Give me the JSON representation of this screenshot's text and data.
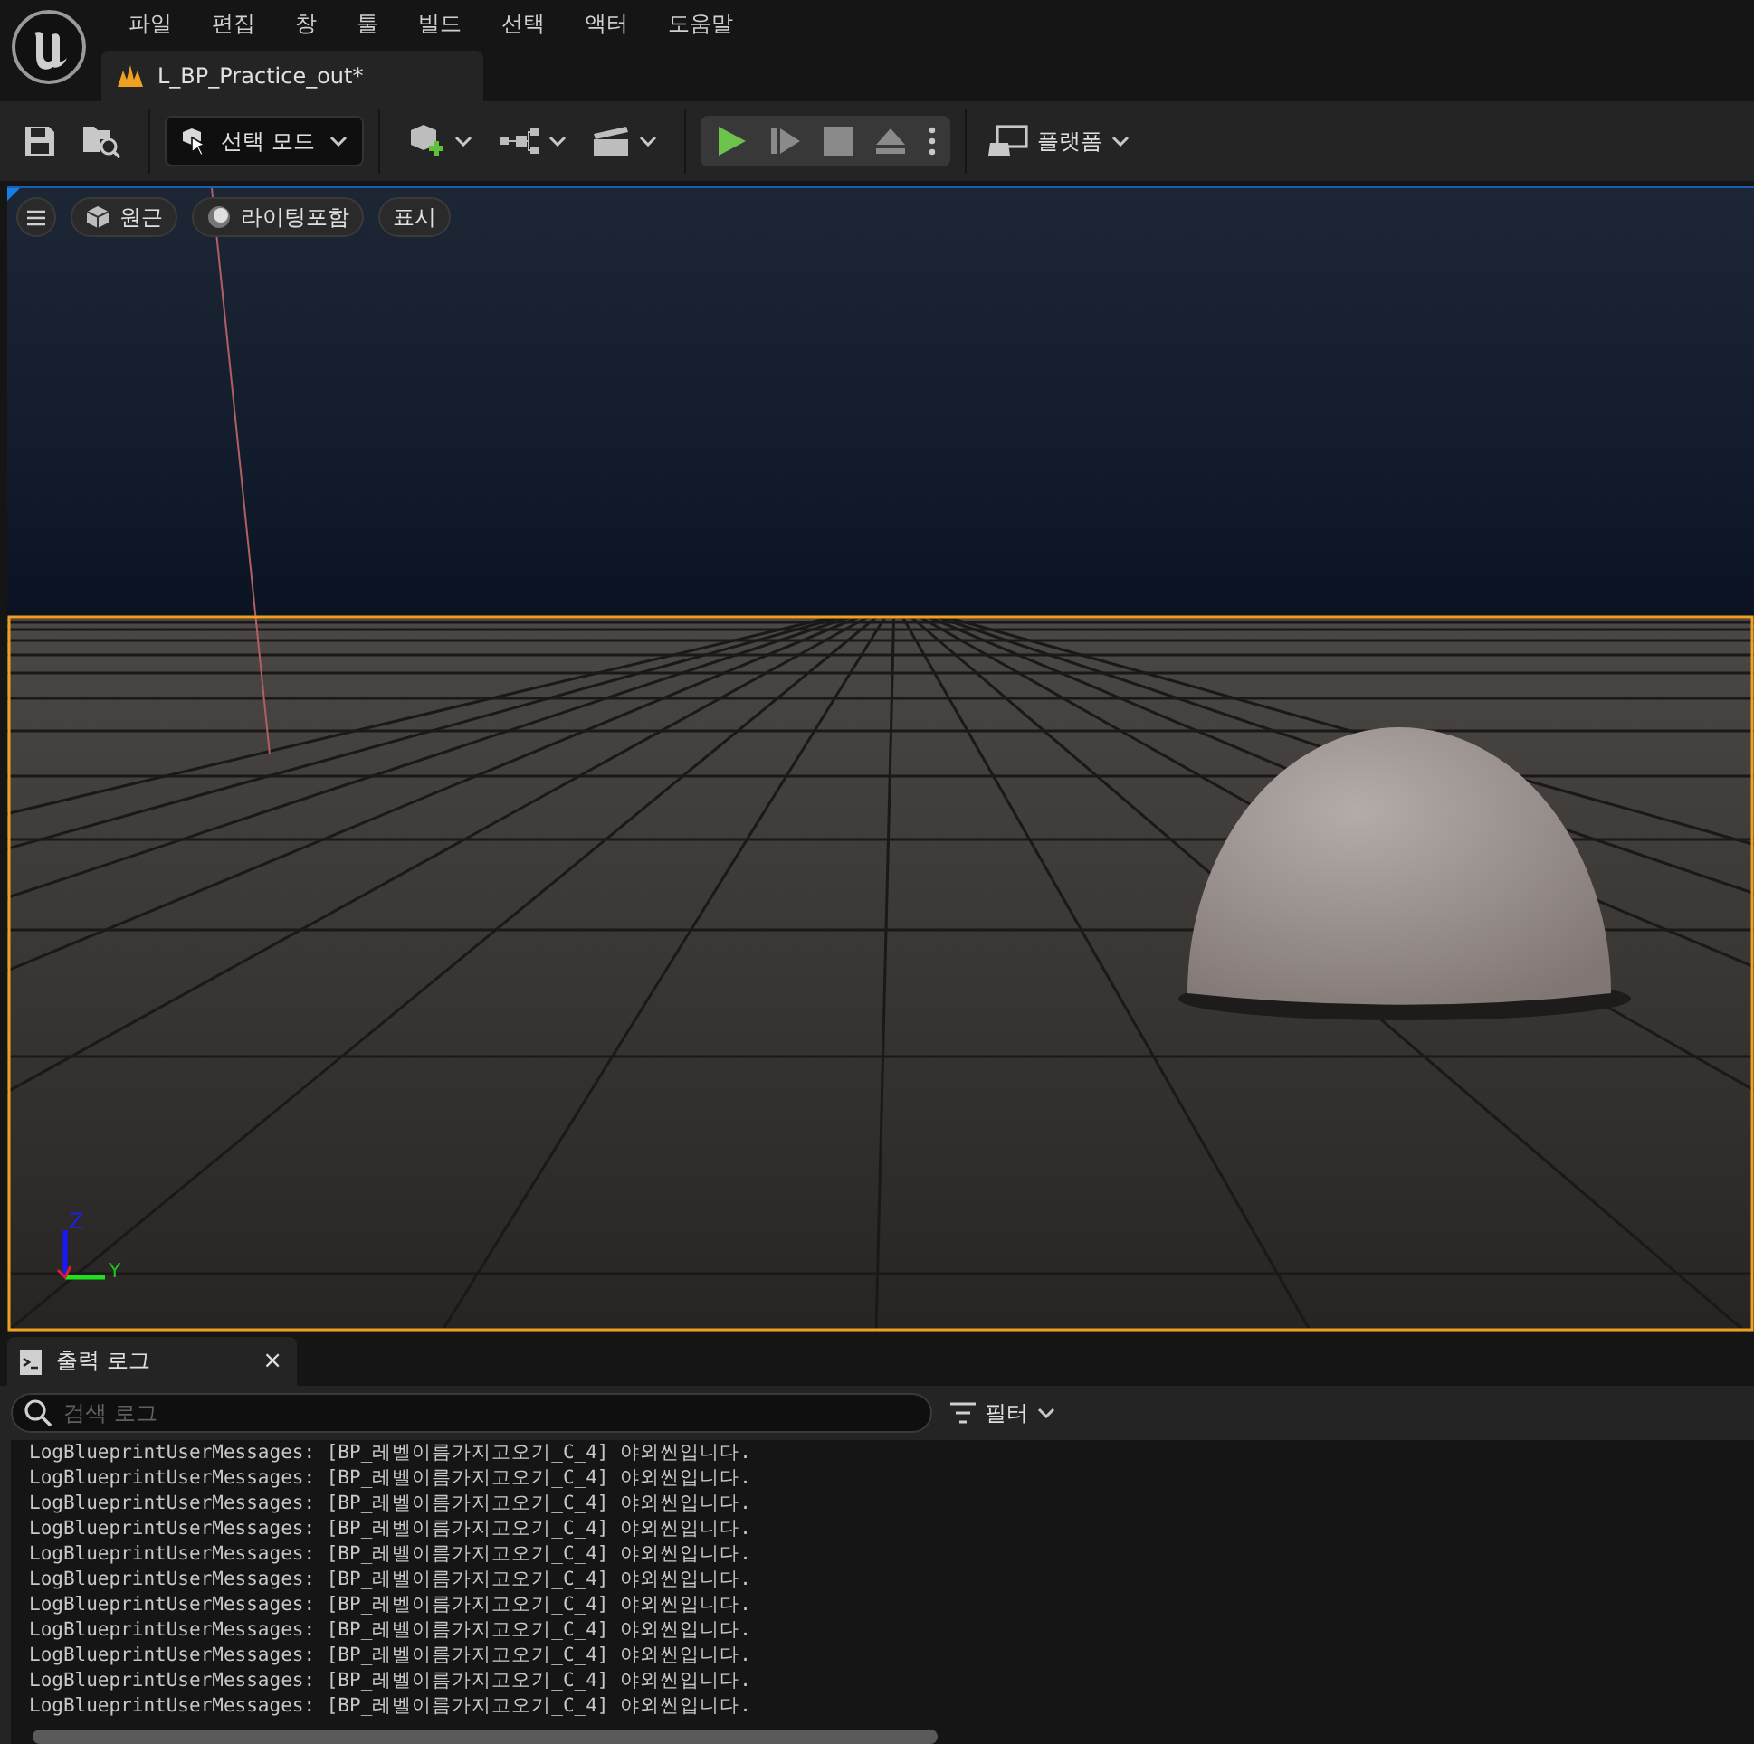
{
  "menu": [
    "파일",
    "편집",
    "창",
    "툴",
    "빌드",
    "선택",
    "액터",
    "도움말"
  ],
  "document_tab": {
    "title": "L_BP_Practice_out*"
  },
  "toolbar": {
    "mode_button": "선택 모드",
    "platform_button": "플랫폼"
  },
  "viewport": {
    "buttons": [
      {
        "label": "원근",
        "kind": "perspective"
      },
      {
        "label": "라이팅포함",
        "kind": "lit"
      },
      {
        "label": "표시",
        "kind": "show"
      }
    ],
    "axes": [
      "Z",
      "Y"
    ]
  },
  "output_log": {
    "tab": "출력 로그",
    "close": "×",
    "search": {
      "placeholder": "검색 로그"
    },
    "filter": "필터",
    "lines": [
      "LogBlueprintUserMessages: [BP_레벨이름가지고오기_C_4] 야외씬입니다.",
      "LogBlueprintUserMessages: [BP_레벨이름가지고오기_C_4] 야외씬입니다.",
      "LogBlueprintUserMessages: [BP_레벨이름가지고오기_C_4] 야외씬입니다.",
      "LogBlueprintUserMessages: [BP_레벨이름가지고오기_C_4] 야외씬입니다.",
      "LogBlueprintUserMessages: [BP_레벨이름가지고오기_C_4] 야외씬입니다.",
      "LogBlueprintUserMessages: [BP_레벨이름가지고오기_C_4] 야외씬입니다.",
      "LogBlueprintUserMessages: [BP_레벨이름가지고오기_C_4] 야외씬입니다.",
      "LogBlueprintUserMessages: [BP_레벨이름가지고오기_C_4] 야외씬입니다.",
      "LogBlueprintUserMessages: [BP_레벨이름가지고오기_C_4] 야외씬입니다.",
      "LogBlueprintUserMessages: [BP_레벨이름가지고오기_C_4] 야외씬입니다.",
      "LogBlueprintUserMessages: [BP_레벨이름가지고오기_C_4] 야외씬입니다."
    ]
  }
}
